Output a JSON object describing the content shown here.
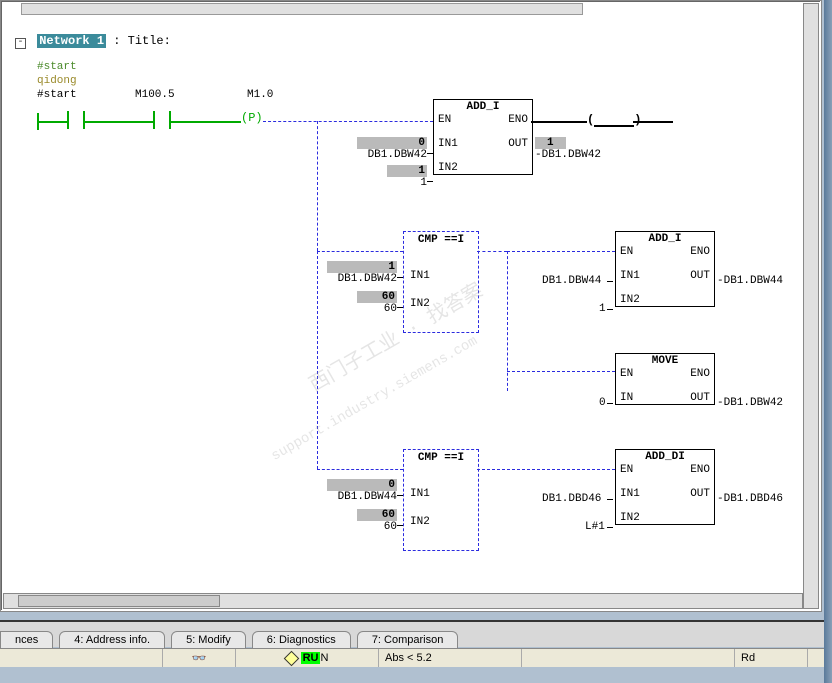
{
  "header": {
    "network_label": "Network 1",
    "title_prefix": ": Title:"
  },
  "symbols": {
    "start_sym": "#start",
    "qidong": "qidong",
    "start2": "#start",
    "m1005": "M100.5",
    "m10": "M1.0",
    "p": "P"
  },
  "blocks": {
    "add_i1": {
      "title": "ADD_I",
      "en": "EN",
      "eno": "ENO",
      "in1": "IN1",
      "out": "OUT",
      "in2": "IN2",
      "in1_val": "0",
      "in1_addr": "DB1.DBW42",
      "in2_val": "1",
      "in2_addr": "1",
      "out_val": "1",
      "out_addr": "DB1.DBW42"
    },
    "cmp1": {
      "title": "CMP ==I",
      "in1": "IN1",
      "in2": "IN2",
      "in1_val": "1",
      "in1_addr": "DB1.DBW42",
      "in2_val": "60",
      "in2_addr": "60"
    },
    "add_i2": {
      "title": "ADD_I",
      "en": "EN",
      "eno": "ENO",
      "in1": "IN1",
      "out": "OUT",
      "in2": "IN2",
      "in1_addr": "DB1.DBW44",
      "in2_addr": "1",
      "out_addr": "DB1.DBW44"
    },
    "move": {
      "title": "MOVE",
      "en": "EN",
      "eno": "ENO",
      "in": "IN",
      "out": "OUT",
      "in_addr": "0",
      "out_addr": "DB1.DBW42"
    },
    "cmp2": {
      "title": "CMP ==I",
      "in1": "IN1",
      "in2": "IN2",
      "in1_val": "0",
      "in1_addr": "DB1.DBW44",
      "in2_val": "60",
      "in2_addr": "60"
    },
    "add_di": {
      "title": "ADD_DI",
      "en": "EN",
      "eno": "ENO",
      "in1": "IN1",
      "out": "OUT",
      "in2": "IN2",
      "in1_addr": "DB1.DBD46",
      "in2_addr": "L#1",
      "out_addr": "DB1.DBD46"
    }
  },
  "tabs": {
    "t0": "nces",
    "t1": "4: Address info.",
    "t2": "5: Modify",
    "t3": "6: Diagnostics",
    "t4": "7: Comparison"
  },
  "status": {
    "run_pre": "RU",
    "run_post": "N",
    "abs": "Abs < 5.2",
    "rd": "Rd"
  },
  "watermark": {
    "l1": "西门子工业 · 找答案",
    "l2": "support.industry.siemens.com"
  }
}
